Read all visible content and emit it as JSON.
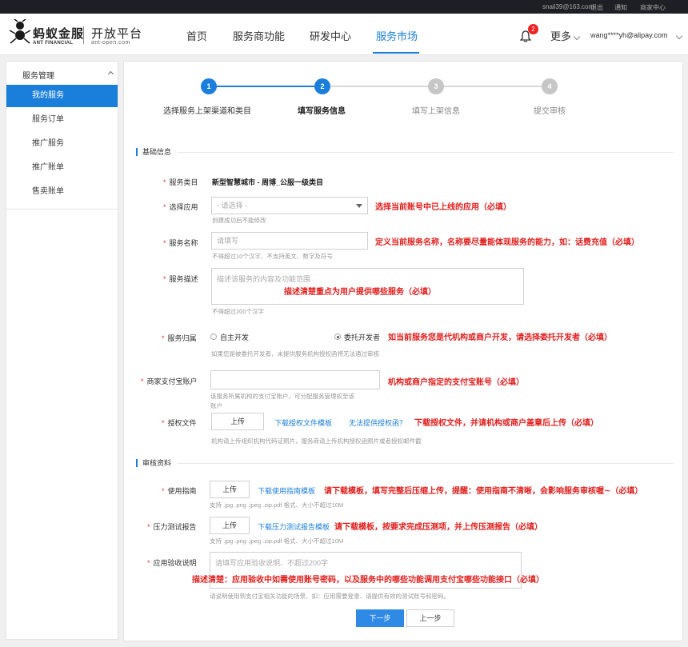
{
  "topbar": {
    "email": "snail39@163.com",
    "logout": "退出",
    "notify": "通知",
    "merchant_center": "商家中心"
  },
  "header": {
    "logo_text": "蚂蚁金服",
    "logo_sub": "ANT FINANCIAL",
    "platform_title": "开放平台",
    "platform_sub": "ant-open.com",
    "nav": [
      "首页",
      "服务商功能",
      "研发中心",
      "服务市场"
    ],
    "active_nav": "服务市场",
    "notification_count": "2",
    "more": "更多",
    "user": "wang****yh@alipay.com",
    "accent_color": "#1a7fdb"
  },
  "sidebar": {
    "group_title": "服务管理",
    "items": [
      "我的服务",
      "服务订单",
      "推广服务",
      "推广账单",
      "售卖账单"
    ],
    "active_item": "我的服务"
  },
  "steps": [
    {
      "num": "1",
      "label": "选择服务上架渠道和类目",
      "state": "done"
    },
    {
      "num": "2",
      "label": "填写服务信息",
      "state": "active"
    },
    {
      "num": "3",
      "label": "填写上架信息",
      "state": "pending"
    },
    {
      "num": "4",
      "label": "提交审核",
      "state": "pending"
    }
  ],
  "basic": {
    "section_title": "基础信息",
    "category_label": "服务类目",
    "category_value": "新型智慧城市 - 周博_公服一级类目",
    "app_label": "选择应用",
    "app_placeholder": "- 请选择 -",
    "app_hint": "创建成功后不能修改",
    "app_annotation": "选择当前账号中已上线的应用（必填）",
    "name_label": "服务名称",
    "name_placeholder": "请填写",
    "name_hint": "不得超过10个汉字、不支持英文、数字及符号",
    "name_annotation": "定义当前服务名称，名称要尽量能体现服务的能力，如：话费充值（必填）",
    "desc_label": "服务描述",
    "desc_placeholder": "描述该服务的内容及功能范围",
    "desc_annotation": "描述清楚重点为用户提供哪些服务（必填）",
    "desc_hint": "不得超过200个汉字",
    "owner_label": "服务归属",
    "owner_option_self": "自主开发",
    "owner_option_delegate": "委托开发者",
    "owner_selected": "委托开发者",
    "owner_annotation": "如当前服务您是代机构或商户开发，请选择委托开发者（必填）",
    "owner_hint": "如果您是被委托开发者，未提供服务机构授权函将无法通过审核",
    "alipay_label": "商家支付宝账户",
    "alipay_annotation": "机构或商户指定的支付宝账号（必填）",
    "alipay_hint_1": "该服务所属机构的支付宝账户，可分配服务管理权至该",
    "alipay_hint_2": "账户",
    "auth_label": "授权文件",
    "auth_upload": "上传",
    "auth_template_link": "下载授权文件模板",
    "auth_no_link": "无法提供授权函？",
    "auth_annotation": "下载授权文件，并请机构或商户盖章后上传（必填）",
    "auth_hint": "机构请上传组织机构代码证照片，服务商请上传机构授权函照片或者授权邮件截"
  },
  "review": {
    "section_title": "审核资料",
    "guide_label": "使用指南",
    "guide_upload": "上传",
    "guide_link": "下载使用指南模板",
    "guide_annotation": "请下载模板，填写完整后压缩上传，提醒：使用指南不清晰，会影响服务审核喔~（必填）",
    "guide_hint": "支持 .jpg .png .jpeg .zip.pdf 格式、大小不超过10M",
    "stress_label": "压力测试报告",
    "stress_upload": "上传",
    "stress_link": "下载压力测试报告模板",
    "stress_annotation": "请下载模板，按要求完成压测项，并上传压测报告（必填）",
    "stress_hint": "支持 .jpg .png .jpeg .zip.pdf 格式、大小不超过10M",
    "accept_label": "应用验收说明",
    "accept_placeholder": "请填写应用验收说明、不超过200字",
    "accept_annotation": "描述清楚：应用验收中如需使用账号密码，以及服务中的哪些功能调用支付宝哪些功能接口（必填）",
    "accept_hint": "请说明使用到支付宝相关功能的场景、如：应用需要登录、请提供有效的测试账号和密码。"
  },
  "actions": {
    "next": "下一步",
    "prev": "上一步"
  }
}
